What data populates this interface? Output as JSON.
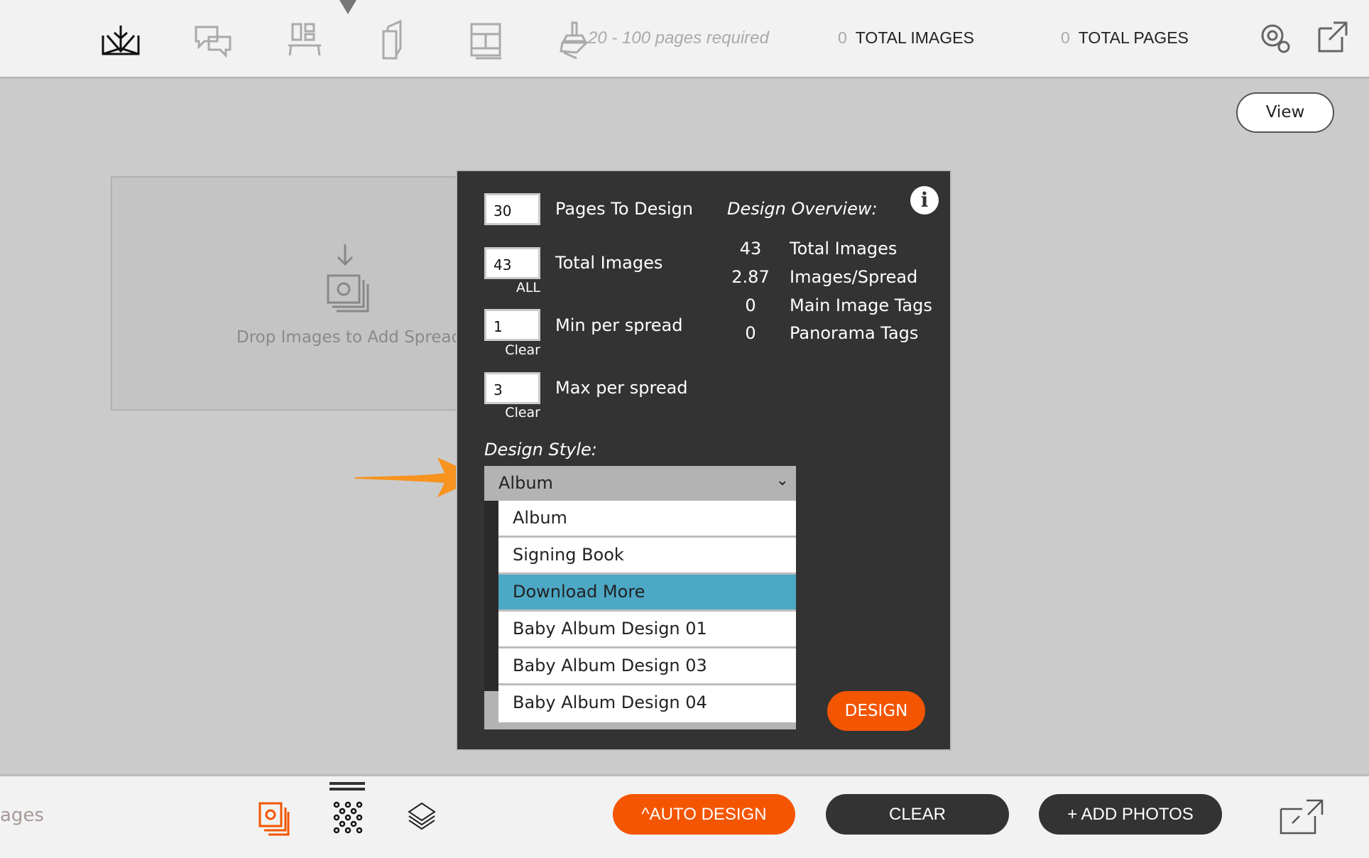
{
  "topbar": {
    "icons": [
      "book-icon",
      "speech-bubbles-icon",
      "layout-icon",
      "pages-icon",
      "grid-layout-icon",
      "stamp-icon"
    ],
    "pages_required": "20 - 100 pages required",
    "total_images": {
      "count": "0",
      "label": "TOTAL IMAGES"
    },
    "total_pages": {
      "count": "0",
      "label": "TOTAL PAGES"
    }
  },
  "view_button": "View",
  "drop_area": {
    "text": "Drop Images to Add Spread"
  },
  "panel": {
    "pages_to_design": {
      "value": "30",
      "label": "Pages To Design"
    },
    "total_images": {
      "value": "43",
      "label": "Total Images",
      "sub": "ALL"
    },
    "min_per_spread": {
      "value": "1",
      "label": "Min per spread",
      "sub": "Clear"
    },
    "max_per_spread": {
      "value": "3",
      "label": "Max per spread",
      "sub": "Clear"
    },
    "overview": {
      "title": "Design Overview:",
      "rows": [
        {
          "value": "43",
          "label": "Total Images"
        },
        {
          "value": "2.87",
          "label": "Images/Spread"
        },
        {
          "value": "0",
          "label": "Main Image Tags"
        },
        {
          "value": "0",
          "label": "Panorama Tags"
        }
      ]
    },
    "design_style": {
      "label": "Design Style:",
      "selected": "Album",
      "options": [
        "Album",
        "Signing Book",
        "Download More",
        "Baby Album Design 01",
        "Baby Album Design 03",
        "Baby Album Design 04"
      ],
      "highlighted": "Download More"
    },
    "design_button": "DESIGN"
  },
  "bottombar": {
    "left_text": "ages",
    "auto_design": "^AUTO DESIGN",
    "clear": "CLEAR",
    "add_photos": "+ ADD PHOTOS"
  },
  "colors": {
    "accent": "#f45500",
    "highlight": "#4ca8c5",
    "panel": "#333333",
    "arrow": "#f7931e"
  }
}
